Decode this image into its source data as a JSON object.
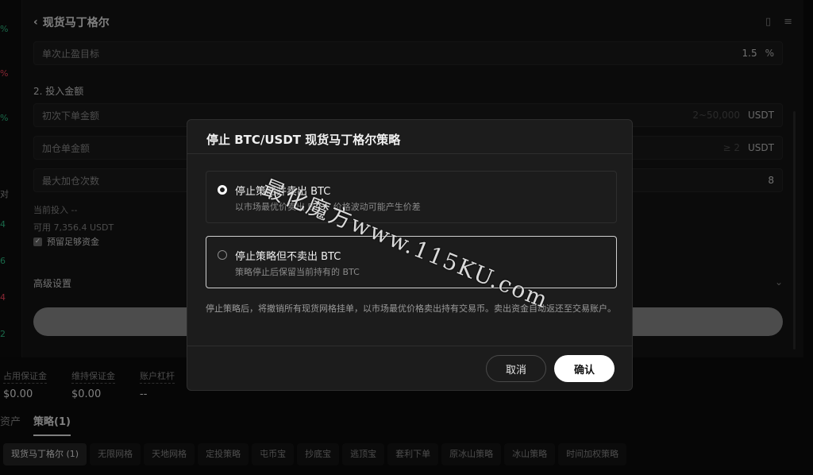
{
  "left_strip": {
    "values": [
      "%",
      "%",
      "%",
      "对",
      "4",
      "6",
      "4",
      "2"
    ]
  },
  "panel": {
    "back_icon": "chevron-left-icon",
    "title": "现货马丁格尔",
    "fields": {
      "take_profit": {
        "label": "单次止盈目标",
        "value": "1.5",
        "unit": "%"
      },
      "initial_order": {
        "label": "初次下单金额",
        "placeholder": "2~50,000",
        "unit": "USDT"
      },
      "add_order": {
        "label": "加仓单金额",
        "placeholder": "≥ 2",
        "unit": "USDT"
      },
      "max_add": {
        "label": "最大加仓次数",
        "value": "8"
      }
    },
    "section2": "2. 投入金额",
    "current_invest": "当前投入 --",
    "available": "可用 7,356.4 USDT",
    "reserve_checkbox": "预留足够资金",
    "advanced": "高级设置"
  },
  "bottom": {
    "metrics": [
      {
        "label": "占用保证金",
        "value": "$0.00"
      },
      {
        "label": "维持保证金",
        "value": "$0.00"
      },
      {
        "label": "账户杠杆",
        "value": "--"
      }
    ],
    "tabs": [
      "资产",
      "策略(1)"
    ],
    "chips": [
      "现货马丁格尔 (1)",
      "无限网格",
      "天地网格",
      "定投策略",
      "屯币宝",
      "抄底宝",
      "逃顶宝",
      "套利下单",
      "原冰山策略",
      "冰山策略",
      "时间加权策略"
    ]
  },
  "modal": {
    "title": "停止 BTC/USDT 现货马丁格尔策略",
    "options": [
      {
        "title": "停止策略并卖出 BTC",
        "desc": "以市场最优价卖出 BTC，价格波动可能产生价差",
        "selected": true
      },
      {
        "title": "停止策略但不卖出 BTC",
        "desc": "策略停止后保留当前持有的 BTC",
        "selected": false
      }
    ],
    "note": "停止策略后，将撤销所有现货网格挂单，以市场最优价格卖出持有交易币。卖出资金自动返还至交易账户。",
    "cancel": "取消",
    "confirm": "确认"
  },
  "watermark": "最化魔方www.115KU.com"
}
